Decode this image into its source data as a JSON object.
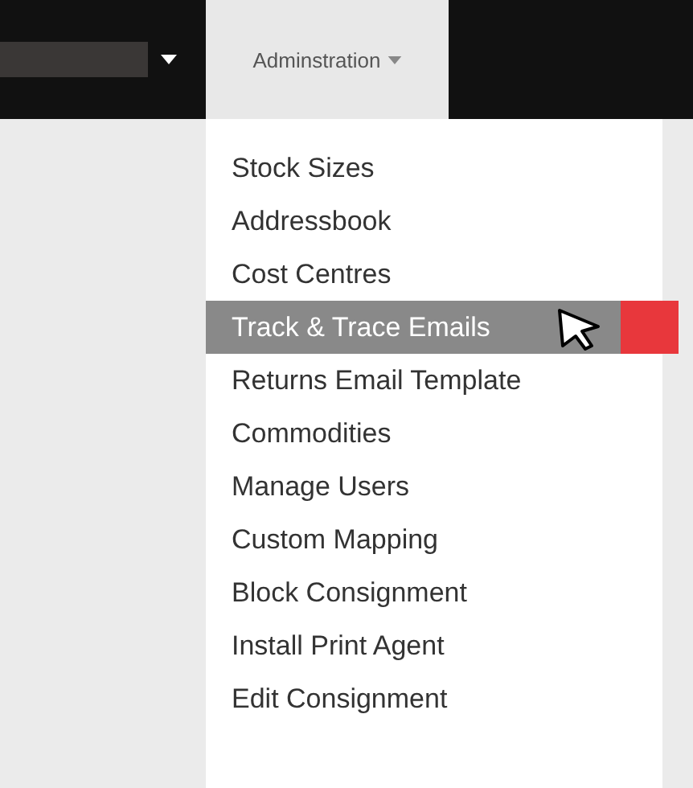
{
  "navbar": {
    "menus": [
      {
        "kind": "field"
      },
      {
        "kind": "tab",
        "label": "Adminstration",
        "expanded": true
      }
    ]
  },
  "dropdown": {
    "items": [
      {
        "label": "Stock Sizes",
        "selected": false
      },
      {
        "label": "Addressbook",
        "selected": false
      },
      {
        "label": "Cost Centres",
        "selected": false
      },
      {
        "label": "Track & Trace Emails",
        "selected": true
      },
      {
        "label": "Returns Email Template",
        "selected": false
      },
      {
        "label": "Commodities",
        "selected": false
      },
      {
        "label": "Manage Users",
        "selected": false
      },
      {
        "label": "Custom Mapping",
        "selected": false
      },
      {
        "label": "Block Consignment",
        "selected": false
      },
      {
        "label": "Install Print Agent",
        "selected": false
      },
      {
        "label": "Edit Consignment",
        "selected": false
      }
    ]
  }
}
